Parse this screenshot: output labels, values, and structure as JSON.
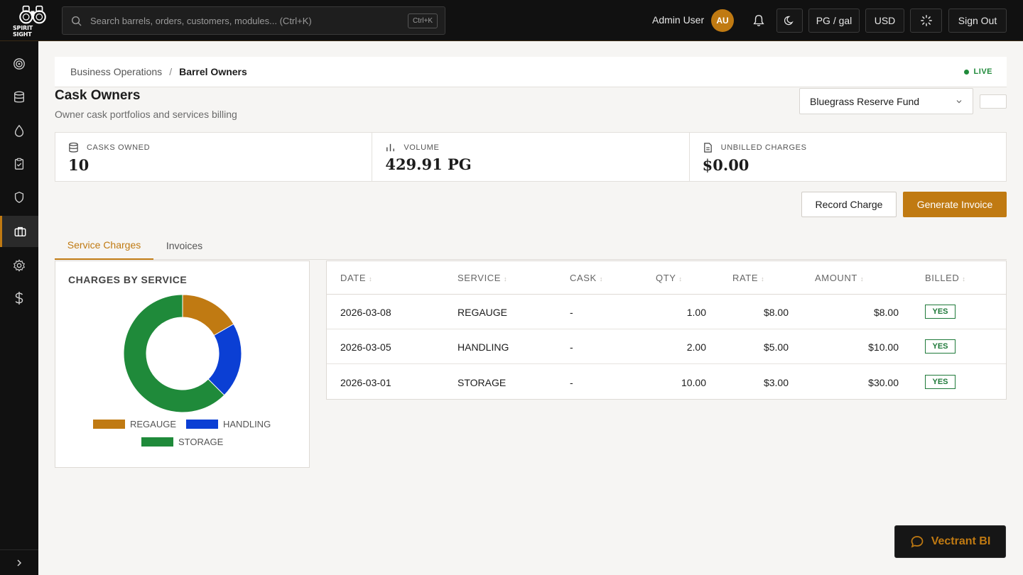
{
  "app": {
    "logo_text": "SPIRIT SIGHT"
  },
  "search": {
    "placeholder": "Search barrels, orders, customers, modules... (Ctrl+K)",
    "shortcut": "Ctrl+K"
  },
  "header": {
    "user_name": "Admin User",
    "avatar_initials": "AU",
    "unit_toggle": "PG / gal",
    "currency": "USD",
    "sign_out": "Sign Out"
  },
  "sidebar": {
    "items": [
      {
        "icon": "target-icon",
        "active": false
      },
      {
        "icon": "database-icon",
        "active": false
      },
      {
        "icon": "droplet-icon",
        "active": false
      },
      {
        "icon": "clipboard-icon",
        "active": false
      },
      {
        "icon": "shield-icon",
        "active": false
      },
      {
        "icon": "briefcase-icon",
        "active": true
      },
      {
        "icon": "gear-icon",
        "active": false
      },
      {
        "icon": "dollar-icon",
        "active": false
      }
    ]
  },
  "breadcrumb": {
    "parent": "Business Operations",
    "current": "Barrel Owners",
    "status": "LIVE"
  },
  "page": {
    "title": "Cask Owners",
    "subtitle": "Owner cask portfolios and services billing",
    "owner_select": "Bluegrass Reserve Fund"
  },
  "stats": [
    {
      "label": "CASKS OWNED",
      "value": "10",
      "icon": "barrel-icon"
    },
    {
      "label": "VOLUME",
      "value": "429.91 PG",
      "icon": "bar-chart-icon"
    },
    {
      "label": "UNBILLED CHARGES",
      "value": "$0.00",
      "icon": "document-icon"
    }
  ],
  "actions": {
    "record_charge": "Record Charge",
    "generate_invoice": "Generate Invoice"
  },
  "tabs": [
    {
      "label": "Service Charges",
      "active": true
    },
    {
      "label": "Invoices",
      "active": false
    }
  ],
  "chart_data": {
    "type": "pie",
    "title": "CHARGES BY SERVICE",
    "categories": [
      "REGAUGE",
      "HANDLING",
      "STORAGE"
    ],
    "values": [
      8,
      10,
      30
    ],
    "colors": [
      "#c07a12",
      "#0b3fd4",
      "#1f8a3a"
    ],
    "legend": "bottom"
  },
  "table": {
    "columns": [
      "DATE",
      "SERVICE",
      "CASK",
      "QTY",
      "RATE",
      "AMOUNT",
      "BILLED"
    ],
    "rows": [
      {
        "date": "2026-03-08",
        "service": "REGAUGE",
        "cask": "-",
        "qty": "1.00",
        "rate": "$8.00",
        "amount": "$8.00",
        "billed": "YES"
      },
      {
        "date": "2026-03-05",
        "service": "HANDLING",
        "cask": "-",
        "qty": "2.00",
        "rate": "$5.00",
        "amount": "$10.00",
        "billed": "YES"
      },
      {
        "date": "2026-03-01",
        "service": "STORAGE",
        "cask": "-",
        "qty": "10.00",
        "rate": "$3.00",
        "amount": "$30.00",
        "billed": "YES"
      }
    ]
  },
  "assistant": {
    "label": "Vectrant BI"
  },
  "colors": {
    "accent": "#c07a12",
    "topbar": "#111111",
    "live": "#1f8a3a"
  }
}
